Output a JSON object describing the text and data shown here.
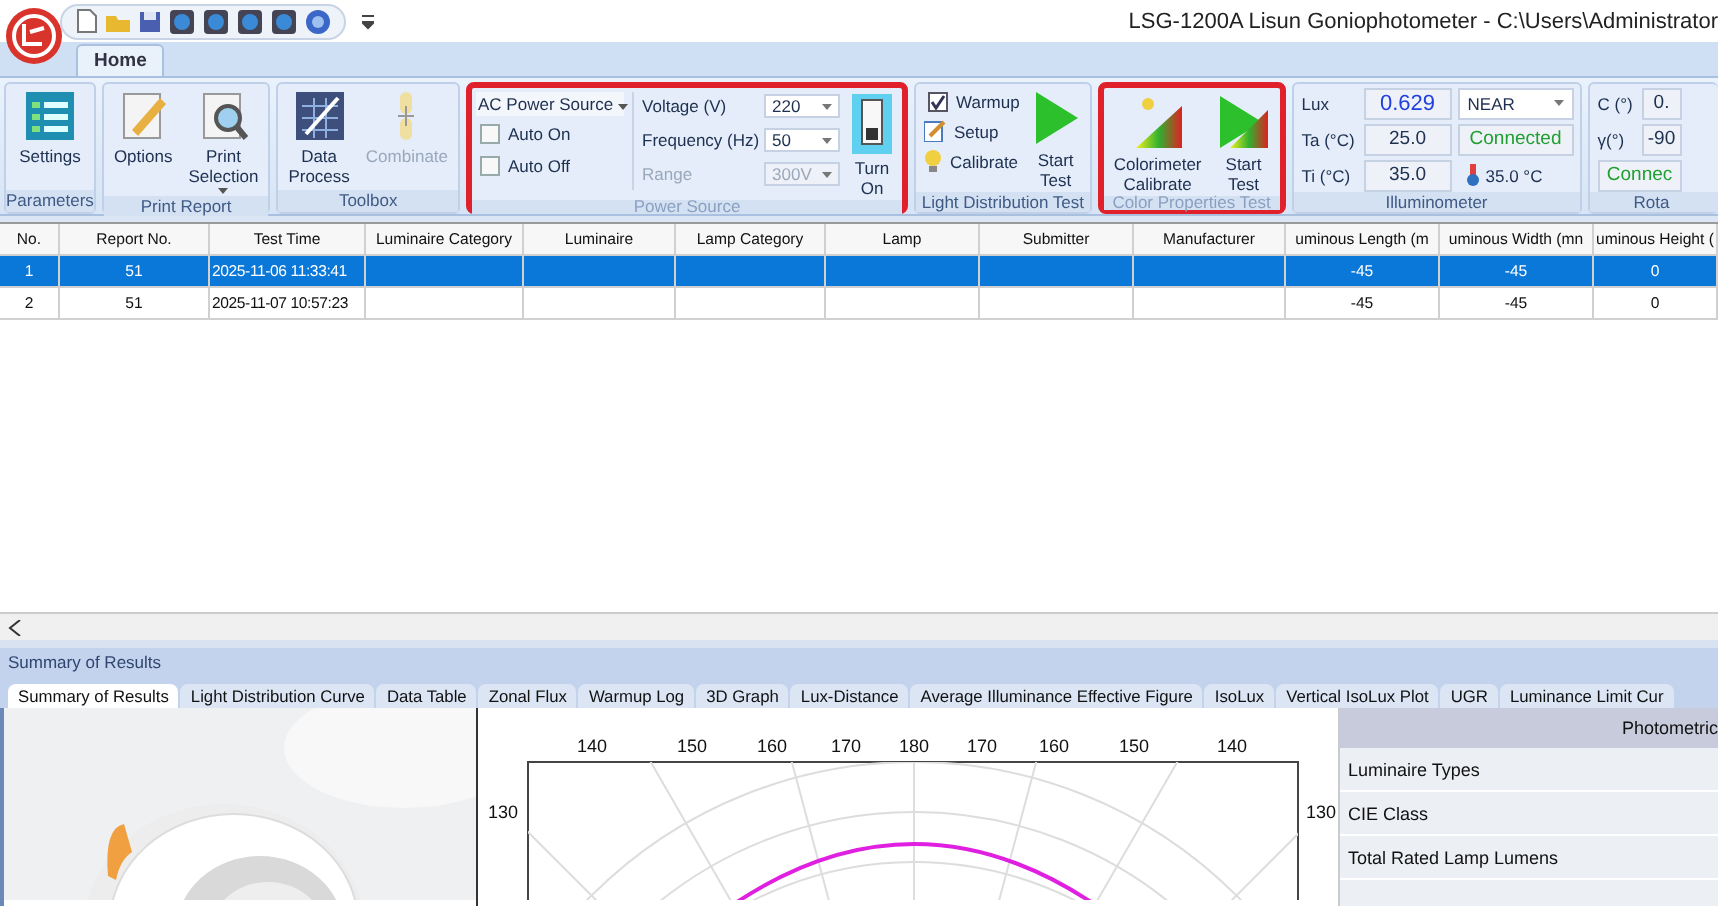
{
  "window": {
    "title": "LSG-1200A Lisun Goniophotometer  - C:\\Users\\Administrator"
  },
  "ribbon_tabs": [
    {
      "label": "Home",
      "selected": true
    }
  ],
  "ribbon": {
    "parameters": {
      "label": "Parameters",
      "settings": "Settings"
    },
    "print_report": {
      "label": "Print Report",
      "options": "Options",
      "print_selection": "Print Selection"
    },
    "toolbox": {
      "label": "Toolbox",
      "data_process": "Data Process",
      "combinate": {
        "label": "Combinate",
        "disabled": true
      }
    },
    "power_source": {
      "label": "Power Source",
      "highlighted": true,
      "source": "AC Power Source",
      "auto_on": {
        "label": "Auto On",
        "checked": false
      },
      "auto_off": {
        "label": "Auto Off",
        "checked": false
      },
      "voltage": {
        "label": "Voltage (V)",
        "value": "220",
        "disabled": false
      },
      "frequency": {
        "label": "Frequency (Hz)",
        "value": "50",
        "disabled": false
      },
      "range": {
        "label": "Range",
        "value": "300V",
        "disabled": true
      },
      "turn_on": "Turn On"
    },
    "light_distribution_test": {
      "label": "Light Distribution Test",
      "warmup": {
        "label": "Warmup",
        "checked": true
      },
      "setup": "Setup",
      "calibrate": "Calibrate",
      "start_test": "Start Test"
    },
    "color_properties_test": {
      "label": "Color Properties Test",
      "highlighted": true,
      "colorimeter_calibrate": "Colorimeter Calibrate",
      "start_test": "Start Test"
    },
    "illuminometer": {
      "label": "Illuminometer",
      "lux": {
        "label": "Lux",
        "value": "0.629"
      },
      "ta": {
        "label": "Ta (°C)",
        "value": "25.0"
      },
      "ti": {
        "label": "Ti (°C)",
        "value": "35.0"
      },
      "mode": "NEAR",
      "status": "Connected",
      "temperature": "35.0 °C"
    },
    "rotation": {
      "label": "Rota",
      "c": {
        "label": "C (°)",
        "value": "0."
      },
      "gamma": {
        "label": "γ(°)",
        "value": "-90"
      },
      "status": "Connec"
    }
  },
  "table": {
    "columns": [
      "No.",
      "Report No.",
      "Test Time",
      "Luminaire Category",
      "Luminaire",
      "Lamp Category",
      "Lamp",
      "Submitter",
      "Manufacturer",
      "uminous Length (m",
      "uminous Width (mn",
      "uminous Height ("
    ],
    "rows": [
      {
        "selected": true,
        "cells": [
          "1",
          "51",
          "2025-11-06 11:33:41",
          "",
          "",
          "",
          "",
          "",
          "",
          "-45",
          "-45",
          "0"
        ]
      },
      {
        "selected": false,
        "cells": [
          "2",
          "51",
          "2025-11-07 10:57:23",
          "",
          "",
          "",
          "",
          "",
          "",
          "-45",
          "-45",
          "0"
        ]
      }
    ]
  },
  "results": {
    "title": "Summary of Results",
    "tabs": [
      {
        "label": "Summary of Results",
        "selected": true
      },
      {
        "label": "Light Distribution Curve",
        "selected": false
      },
      {
        "label": "Data Table",
        "selected": false
      },
      {
        "label": "Zonal Flux",
        "selected": false
      },
      {
        "label": "Warmup Log",
        "selected": false
      },
      {
        "label": "3D Graph",
        "selected": false
      },
      {
        "label": "Lux-Distance",
        "selected": false
      },
      {
        "label": "Average Illuminance Effective Figure",
        "selected": false
      },
      {
        "label": "IsoLux",
        "selected": false
      },
      {
        "label": "Vertical IsoLux Plot",
        "selected": false
      },
      {
        "label": "UGR",
        "selected": false
      },
      {
        "label": "Luminance Limit Cur",
        "selected": false
      }
    ],
    "polar_plot": {
      "top_labels": [
        "140",
        "150",
        "160",
        "170",
        "180",
        "170",
        "160",
        "150",
        "140"
      ],
      "left_label": "130",
      "right_label": "130"
    },
    "photometric": {
      "header": "Photometric",
      "rows": [
        "Luminaire Types",
        "CIE Class",
        "Total Rated Lamp Lumens"
      ]
    }
  }
}
